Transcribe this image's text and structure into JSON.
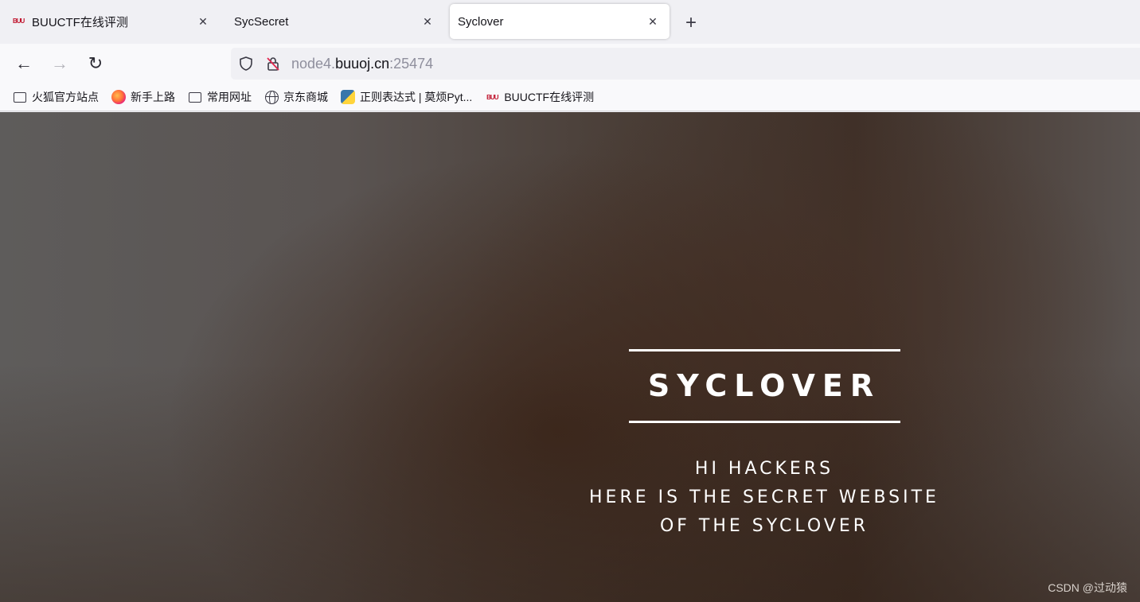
{
  "tabs": [
    {
      "label": "BUUCTF在线评测",
      "favicon": "buuctf-icon",
      "active": false
    },
    {
      "label": "SycSecret",
      "active": false
    },
    {
      "label": "Syclover",
      "active": true
    }
  ],
  "new_tab_symbol": "+",
  "close_symbol": "✕",
  "nav": {
    "back_symbol": "←",
    "forward_symbol": "→",
    "reload_symbol": "↻"
  },
  "url": {
    "prefix": "node4.",
    "host": "buuoj.cn",
    "port": ":25474"
  },
  "bookmarks": [
    {
      "label": "火狐官方站点",
      "icon": "folder-icon"
    },
    {
      "label": "新手上路",
      "icon": "firefox-icon"
    },
    {
      "label": "常用网址",
      "icon": "folder-icon"
    },
    {
      "label": "京东商城",
      "icon": "globe-icon"
    },
    {
      "label": "正则表达式 | 莫烦Pyt...",
      "icon": "python-icon"
    },
    {
      "label": "BUUCTF在线评测",
      "icon": "buuctf-icon"
    }
  ],
  "page": {
    "brand": "SYCLOVER",
    "line1": "HI HACKERS",
    "line2": "HERE IS THE SECRET WEBSITE",
    "line3": "OF THE SYCLOVER"
  },
  "watermark": "CSDN @过动猿"
}
